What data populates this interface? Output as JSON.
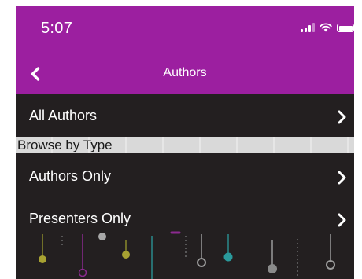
{
  "status_bar": {
    "time": "5:07",
    "icons": [
      "signal-icon",
      "wifi-icon",
      "battery-icon"
    ]
  },
  "nav": {
    "title": "Authors",
    "back_icon": "chevron-left-icon"
  },
  "rows": {
    "all_authors": "All Authors",
    "authors_only": "Authors Only",
    "presenters_only": "Presenters Only"
  },
  "section": {
    "browse_by_type": "Browse by Type"
  },
  "colors": {
    "brand": "#9c1fa0",
    "list_background": "#231f20",
    "section_background": "#d9d9d9"
  }
}
